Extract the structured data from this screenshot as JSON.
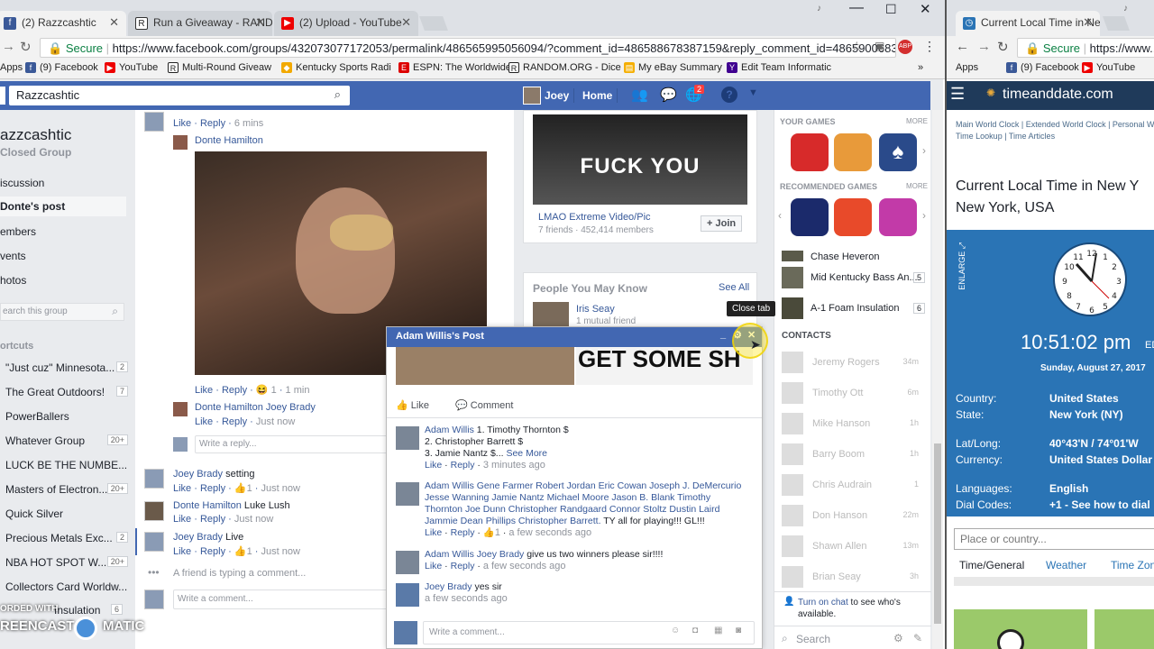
{
  "tabs": [
    {
      "title": "(2) Razzcashtic"
    },
    {
      "title": "Run a Giveaway - RAND"
    },
    {
      "title": "(2) Upload - YouTube"
    }
  ],
  "tabs2": [
    {
      "title": "Current Local Time in Ne"
    }
  ],
  "address": {
    "secure": "Secure",
    "url": "https://www.facebook.com/groups/432073077172053/permalink/486565995056094/?comment_id=486588678387159&reply_comment_id=4865900683870..."
  },
  "address2": {
    "secure": "Secure",
    "url": "https://www..."
  },
  "bookmarks": [
    {
      "label": "Apps",
      "icon": "apps-icon"
    },
    {
      "label": "(9) Facebook",
      "icon": "facebook-icon"
    },
    {
      "label": "YouTube",
      "icon": "youtube-icon"
    },
    {
      "label": "Multi-Round Giveaw",
      "icon": "random-icon"
    },
    {
      "label": "Kentucky Sports Radi",
      "icon": "ksr-icon"
    },
    {
      "label": "ESPN: The Worldwide",
      "icon": "espn-icon"
    },
    {
      "label": "RANDOM.ORG - Dice",
      "icon": "random-icon"
    },
    {
      "label": "My eBay Summary",
      "icon": "ebay-icon"
    },
    {
      "label": "Edit Team Informatic",
      "icon": "yahoo-icon"
    }
  ],
  "bookmarks2": [
    {
      "label": "Apps"
    },
    {
      "label": "(9) Facebook"
    },
    {
      "label": "YouTube"
    }
  ],
  "fb": {
    "search_value": "Razzcashtic",
    "user": "Joey",
    "home": "Home",
    "badge": "2"
  },
  "group": {
    "name": "azzcashtic",
    "type": "Closed Group",
    "nav": [
      "iscussion",
      "Donte's post",
      "embers",
      "vents",
      "hotos"
    ],
    "search_placeholder": "earch this group",
    "shortcuts_title": "ortcuts",
    "shortcuts": [
      {
        "label": "\"Just cuz\" Minnesota...",
        "count": "2"
      },
      {
        "label": "The Great Outdoors!",
        "count": "7"
      },
      {
        "label": "PowerBallers",
        "count": ""
      },
      {
        "label": "Whatever Group",
        "count": "20+"
      },
      {
        "label": "LUCK BE THE NUMBE...",
        "count": ""
      },
      {
        "label": "Masters of Electron...",
        "count": "20+"
      },
      {
        "label": "Quick Silver",
        "count": ""
      },
      {
        "label": "Precious Metals Exc...",
        "count": "2"
      },
      {
        "label": "NBA HOT SPOT W...",
        "count": "20+"
      },
      {
        "label": "Collectors Card Worldw...",
        "count": ""
      },
      {
        "label": "Insulation",
        "count": "6"
      }
    ]
  },
  "feed": {
    "top_actions": {
      "like": "Like",
      "reply": "Reply",
      "time": "6 mins"
    },
    "post_author": "Donte Hamilton",
    "gif_actions": {
      "like": "Like",
      "reply": "Reply",
      "count": "1",
      "time": "1 min"
    },
    "comments": [
      {
        "author": "Donte Hamilton",
        "text": "Joey Brady",
        "like": "Like",
        "reply": "Reply",
        "time": "Just now"
      }
    ],
    "reply_placeholder": "Write a reply...",
    "thread": [
      {
        "author": "Joey Brady",
        "text": "setting",
        "like": "Like",
        "reply": "Reply",
        "count": "1",
        "time": "Just now"
      },
      {
        "author": "Donte Hamilton",
        "text": "Luke Lush",
        "like": "Like",
        "reply": "Reply",
        "time": "Just now"
      },
      {
        "author": "Joey Brady",
        "text": "Live",
        "like": "Like",
        "reply": "Reply",
        "count": "1",
        "time": "Just now"
      }
    ],
    "typing": "A friend is typing a comment...",
    "comment_placeholder": "Write a comment..."
  },
  "page_card": {
    "name": "LMAO Extreme Video/Pic",
    "meta": "7 friends · 452,414 members",
    "join": "+ Join",
    "img_text": "FUCK YOU"
  },
  "pymk": {
    "title": "People You May Know",
    "see_all": "See All",
    "name": "Iris Seay",
    "mutual": "1 mutual friend"
  },
  "tooltip": "Close tab",
  "sidebar": {
    "your_games": "YOUR GAMES",
    "more": "MORE",
    "recommended": "RECOMMENDED GAMES",
    "more2": "MORE",
    "groups": [
      {
        "name": "Chase Heveron",
        "count": ""
      },
      {
        "name": "Mid Kentucky Bass An...",
        "count": "5"
      },
      {
        "name": "A-1 Foam Insulation",
        "count": "6"
      }
    ],
    "contacts_title": "CONTACTS",
    "contacts": [
      {
        "name": "Jeremy Rogers",
        "t": "34m"
      },
      {
        "name": "Timothy Ott",
        "t": "6m"
      },
      {
        "name": "Mike Hanson",
        "t": "1h"
      },
      {
        "name": "Barry Boom",
        "t": "1h"
      },
      {
        "name": "Chris Audrain",
        "t": "1"
      },
      {
        "name": "Don Hanson",
        "t": "22m"
      },
      {
        "name": "Shawn Allen",
        "t": "13m"
      },
      {
        "name": "Brian Seay",
        "t": "3h"
      }
    ],
    "chat_on": "Turn on chat",
    "chat_rest": " to see who's available.",
    "search": "Search"
  },
  "popup": {
    "title": "Adam Willis's Post",
    "img_text": "GET SOME SH",
    "like": "Like",
    "comment": "Comment",
    "comments": [
      {
        "author": "Adam Willis",
        "text": "1. Timothy Thornton $",
        "line2": "2. Christopher Barrett $",
        "line3": "3. Jamie Nantz $...",
        "more": "See More",
        "like": "Like",
        "reply": "Reply",
        "time": "3 minutes ago"
      },
      {
        "author": "Adam Willis",
        "text": "Gene Farmer Robert Jordan Eric Cowan Joseph J. DeMercurio Jesse Wanning Jamie Nantz Michael Moore Jason B. Blank Timothy Thornton Joe Dunn Christopher Randgaard Connor Stoltz Dustin Laird Jammie Dean Phillips Christopher Barrett.",
        "tail": " TY all for playing!!! GL!!!",
        "like": "Like",
        "reply": "Reply",
        "count": "1",
        "time": "a few seconds ago"
      },
      {
        "author": "Adam Willis",
        "mention": "Joey Brady",
        "text": " give us two winners please sir!!!!",
        "like": "Like",
        "reply": "Reply",
        "time": "a few seconds ago"
      },
      {
        "author": "Joey Brady",
        "text": " yes sir",
        "time": "a few seconds ago"
      }
    ],
    "write": "Write a comment..."
  },
  "tad": {
    "brand": "timeanddate.com",
    "links": [
      "Main World Clock",
      "Extended World Clock",
      "Personal W",
      "Time Lookup",
      "Time Articles"
    ],
    "heading": "Current Local Time in New Y",
    "heading2": "New York, USA",
    "enlarge": "ENLARGE",
    "time": "10:51:02 pm",
    "ampm_suffix": "ED",
    "date": "Sunday, August 27, 2017",
    "rows": [
      {
        "k": "Country:",
        "v": "United States"
      },
      {
        "k": "State:",
        "v": "New York (NY)"
      },
      {
        "k": "Lat/Long:",
        "v": "40°43'N / 74°01'W"
      },
      {
        "k": "Currency:",
        "v": "United States Dollar (U"
      },
      {
        "k": "Languages:",
        "v": "English"
      },
      {
        "k": "Dial Codes:",
        "v": "+1 - See how to dial"
      }
    ],
    "place_placeholder": "Place or country...",
    "tabs": [
      "Time/General",
      "Weather",
      "Time Zone"
    ]
  },
  "watermark": {
    "line1": "ORDED WITH",
    "line2": "REENCAST",
    "line3": "MATIC"
  },
  "colors": {
    "fb_blue": "#4267b2",
    "link": "#365899",
    "tad_blue": "#2a74b5"
  }
}
